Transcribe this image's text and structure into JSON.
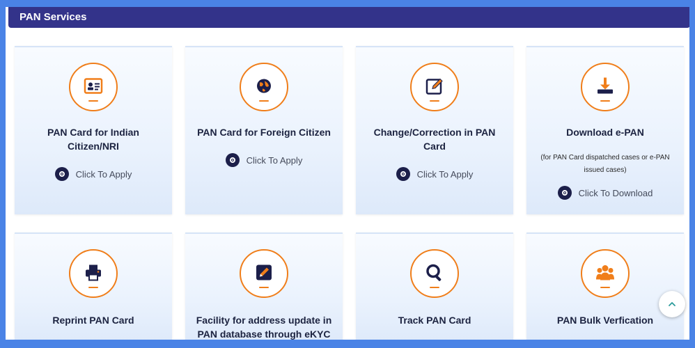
{
  "header": {
    "title": "PAN Services"
  },
  "cards_row1": [
    {
      "title": "PAN Card for Indian Citizen/NRI",
      "action": "Click To Apply",
      "icon": "id-card-icon"
    },
    {
      "title": "PAN Card for Foreign Citizen",
      "action": "Click To Apply",
      "icon": "globe-icon"
    },
    {
      "title": "Change/Correction in PAN Card",
      "action": "Click To Apply",
      "icon": "edit-icon"
    },
    {
      "title": "Download e-PAN",
      "subtitle": "(for PAN Card dispatched cases or e-PAN issued cases)",
      "action": "Click To Download",
      "icon": "download-icon"
    }
  ],
  "cards_row2": [
    {
      "title": "Reprint PAN Card",
      "icon": "printer-icon"
    },
    {
      "title": "Facility for address update in PAN database through eKYC",
      "icon": "pencil-icon"
    },
    {
      "title": "Track PAN Card",
      "icon": "search-icon"
    },
    {
      "title": "PAN Bulk Verfication",
      "icon": "users-icon"
    }
  ],
  "colors": {
    "accent": "#f07e1a",
    "header_bg": "#33338a",
    "frame": "#4a83e6",
    "dark_navy": "#1c1f4a"
  }
}
